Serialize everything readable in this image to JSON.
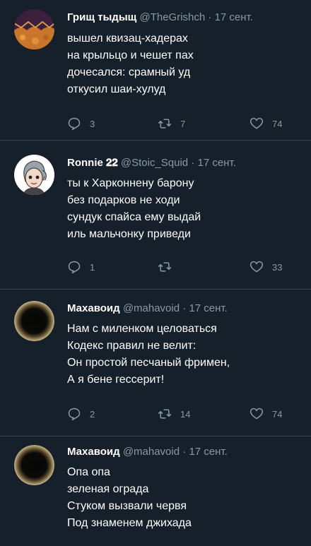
{
  "tweets": [
    {
      "name": "Грищ тыдыщ",
      "handle": "@TheGrishch",
      "sep": "·",
      "date": "17 сент.",
      "lines": [
        "вышел квизац-хадерах",
        "на крыльцо и чешет пах",
        "дочесался: срамный уд",
        "откусил шаи-хулуд"
      ],
      "replies": "3",
      "retweets": "7",
      "likes": "74"
    },
    {
      "name": "Ronnie 𝟐𝟐",
      "handle": "@Stoic_Squid",
      "sep": "·",
      "date": "17 сент.",
      "lines": [
        "ты к Харконнену барону",
        "без подарков не ходи",
        "сундук спайса ему выдай",
        "иль мальчонку приведи"
      ],
      "replies": "1",
      "retweets": "",
      "likes": "33"
    },
    {
      "name": "Махавоид",
      "handle": "@mahavoid",
      "sep": "·",
      "date": "17 сент.",
      "lines": [
        "Нам с миленком целоваться",
        "Кодекс правил не велит:",
        "Он простой песчаный фримен,",
        "А я бене гессерит!"
      ],
      "replies": "2",
      "retweets": "14",
      "likes": "74"
    },
    {
      "name": "Махавоид",
      "handle": "@mahavoid",
      "sep": "·",
      "date": "17 сент.",
      "lines": [
        "Опа опа",
        "зеленая ограда",
        "Стуком вызвали червя",
        "Под знаменем джихада"
      ]
    }
  ],
  "colors": {
    "background": "#15202b",
    "text": "#ffffff",
    "muted": "#8899a6",
    "divider": "#38444d"
  },
  "icons": {
    "reply": "reply-icon",
    "retweet": "retweet-icon",
    "like": "heart-icon"
  }
}
